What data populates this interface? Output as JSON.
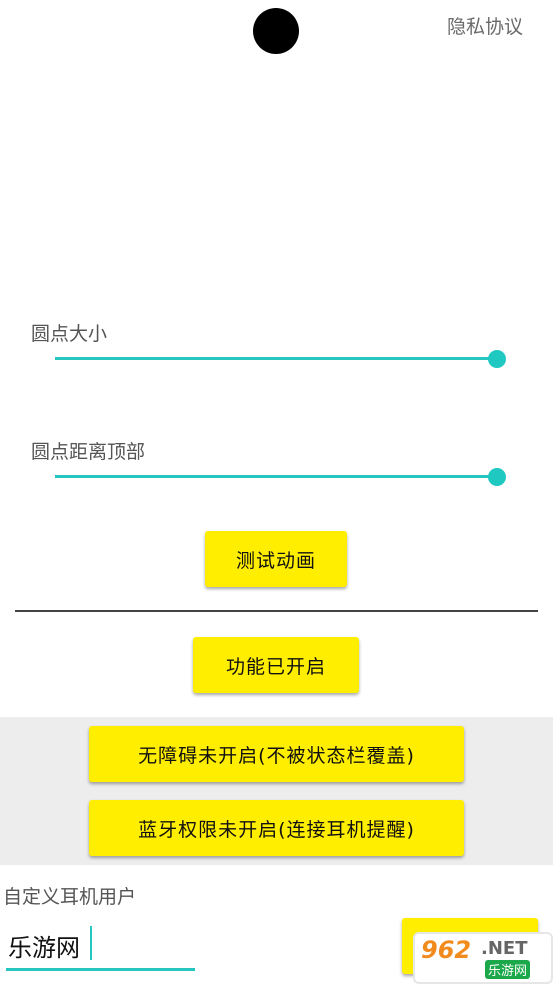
{
  "header": {
    "privacy_link": "隐私协议"
  },
  "sliders": {
    "dot_size": {
      "label": "圆点大小",
      "value": 1.0
    },
    "dot_distance": {
      "label": "圆点距离顶部",
      "value": 1.0
    }
  },
  "buttons": {
    "test_animation": "测试动画",
    "feature_status": "功能已开启",
    "accessibility": "无障碍未开启(不被状态栏覆盖)",
    "bluetooth": "蓝牙权限未开启(连接耳机提醒)"
  },
  "custom_user": {
    "label": "自定义耳机用户",
    "input_value": "乐游网"
  },
  "watermark": {
    "number": "962",
    "net": ".NET",
    "site": "乐游网"
  },
  "colors": {
    "accent": "#26c6c0",
    "button": "#ffee00",
    "band": "#ededed"
  }
}
